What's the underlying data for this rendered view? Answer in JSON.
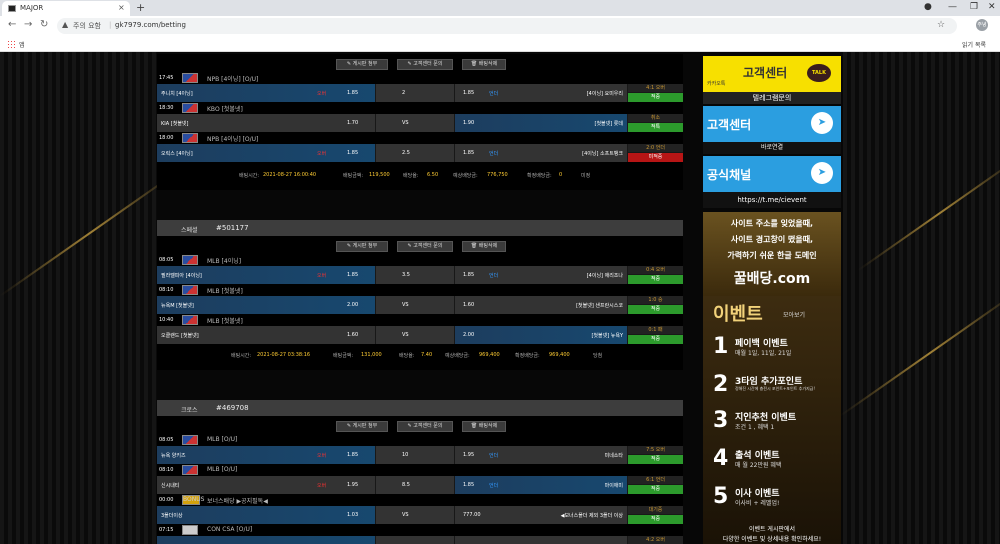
{
  "browser": {
    "tab_title": "MAJOR",
    "warn_label": "주의 요함",
    "url": "gk7979.com/betting",
    "apps_label": "앱",
    "reading_list": "읽기 목록",
    "avatar": "주녕"
  },
  "actions": {
    "post": "✎ 게시판 첨부",
    "contact": "✎ 고객센터 문의",
    "delete": "🗑 배팅삭제"
  },
  "bets": [
    {
      "legs": [
        {
          "time": "17:45",
          "league": "NPB [4이닝] [O/U]",
          "home": "주니치 [4이닝]",
          "home_odds": "1.85",
          "mid_label": "오버",
          "line": "2",
          "away_odds": "1.85",
          "away_label": "언더",
          "away": "[4이닝] 요미우리",
          "result": "4:1 오버",
          "status": "적중",
          "status_type": "win",
          "sel": "home"
        },
        {
          "time": "18:30",
          "league": "KBO [첫볼넷]",
          "home": "KIA [첫볼넷]",
          "home_odds": "1.70",
          "mid_label": "",
          "line": "VS",
          "away_odds": "1.90",
          "away_label": "",
          "away": "[첫볼넷] 롯데",
          "result": "취소",
          "status": "적특",
          "status_type": "win",
          "sel": "away"
        },
        {
          "time": "18:00",
          "league": "NPB [4이닝] [O/U]",
          "home": "오릭스 [4이닝]",
          "home_odds": "1.85",
          "mid_label": "오버",
          "line": "2.5",
          "away_odds": "1.85",
          "away_label": "언더",
          "away": "[4이닝] 소프트뱅크",
          "result": "2:0 언더",
          "status": "미적중",
          "status_type": "lose",
          "sel": "home"
        }
      ],
      "summary": {
        "time_lbl": "배팅시간:",
        "time": "2021-08-27 16:00:40",
        "amt_lbl": "배팅금액:",
        "amt": "119,500",
        "odds_lbl": "배당율:",
        "odds": "6.50",
        "exp_lbl": "예상배당금:",
        "exp": "776,750",
        "conf_lbl": "확정배당금:",
        "conf": "0",
        "state": "미정"
      }
    },
    {
      "type": "스페셜",
      "id": "#501177",
      "legs": [
        {
          "time": "08:05",
          "league": "MLB [4이닝]",
          "home": "필라델피아 [4이닝]",
          "home_odds": "1.85",
          "mid_label": "오버",
          "line": "3.5",
          "away_odds": "1.85",
          "away_label": "언더",
          "away": "[4이닝] 애리조나",
          "result": "0:4 오버",
          "status": "적중",
          "status_type": "win",
          "sel": "home"
        },
        {
          "time": "08:10",
          "league": "MLB [첫볼넷]",
          "home": "뉴욕M [첫볼넷]",
          "home_odds": "2.00",
          "mid_label": "",
          "line": "VS",
          "away_odds": "1.60",
          "away_label": "",
          "away": "[첫볼넷] 샌프란시스코",
          "result": "1:0 승",
          "status": "적중",
          "status_type": "win",
          "sel": "home"
        },
        {
          "time": "10:40",
          "league": "MLB [첫볼넷]",
          "home": "오클랜드 [첫볼넷]",
          "home_odds": "1.60",
          "mid_label": "",
          "line": "VS",
          "away_odds": "2.00",
          "away_label": "",
          "away": "[첫볼넷] 뉴욕Y",
          "result": "0:1 패",
          "status": "적중",
          "status_type": "win",
          "sel": "away"
        }
      ],
      "summary": {
        "time_lbl": "배팅시간:",
        "time": "2021-08-27 03:38:16",
        "amt_lbl": "배팅금액:",
        "amt": "131,000",
        "odds_lbl": "배당율:",
        "odds": "7.40",
        "exp_lbl": "예상배당금:",
        "exp": "969,400",
        "conf_lbl": "확정배당금:",
        "conf": "969,400",
        "state": "당첨"
      }
    },
    {
      "type": "크로스",
      "id": "#469708",
      "legs": [
        {
          "time": "08:05",
          "league": "MLB [O/U]",
          "home": "뉴욕 양키즈",
          "home_odds": "1.85",
          "mid_label": "오버",
          "line": "10",
          "away_odds": "1.95",
          "away_label": "언더",
          "away": "미네소타",
          "result": "7:5 오버",
          "status": "적중",
          "status_type": "win",
          "sel": "home"
        },
        {
          "time": "08:10",
          "league": "MLB [O/U]",
          "home": "신시내티",
          "home_odds": "1.95",
          "mid_label": "오버",
          "line": "8.5",
          "away_odds": "1.85",
          "away_label": "언더",
          "away": "마이애미",
          "result": "6:1 언더",
          "status": "적중",
          "status_type": "win",
          "sel": "away"
        },
        {
          "time": "00:00",
          "league": "보너스배당 ▶공지필독◀",
          "home": "3폴더이상",
          "home_odds": "1.03",
          "mid_label": "",
          "line": "VS",
          "away_odds": "777.00",
          "away_label": "",
          "away": "◀보너스폴더 제외 3폴더 이상",
          "result": "대기중",
          "status": "적중",
          "status_type": "wait",
          "sel": "home",
          "bonus": "BONUS"
        },
        {
          "time": "07:15",
          "league": "CON CSA [O/U]",
          "home": "",
          "home_odds": "",
          "mid_label": "",
          "line": "",
          "away_odds": "",
          "away_label": "",
          "away": "",
          "result": "4:2 오버",
          "status": "",
          "status_type": "win",
          "sel": "home"
        }
      ]
    }
  ],
  "side": {
    "kakao": {
      "label": "카카오톡",
      "title": "고객센터",
      "talk": "TALK",
      "sub": "텔레그램문의"
    },
    "tele1": {
      "title": "고객센터",
      "sub": "바로연결"
    },
    "tele2": {
      "title": "공식채널",
      "sub": "https://t.me/cievent"
    },
    "ad1": {
      "l1": "사이트 주소를 잊었을때,",
      "l2": "사이트 경고창이 떴을때,",
      "l3": "가력하기 쉬운 한글 도메인",
      "l4": "꿀배당.com"
    },
    "ad2": {
      "title": "이벤트",
      "sub": "모아보기",
      "events": [
        {
          "n": "1",
          "a": "페이백 이벤트",
          "b": "매월 1일, 11일, 21일"
        },
        {
          "n": "2",
          "a": "3타임 추가포인트",
          "b": "정해진 시간에 충전시 포인트+포인트 추가지급!"
        },
        {
          "n": "3",
          "a": "지인추천 이벤트",
          "b": "조건 1 , 혜택 1"
        },
        {
          "n": "4",
          "a": "출석 이벤트",
          "b": "매 월 22만원 혜택"
        },
        {
          "n": "5",
          "a": "이사 이벤트",
          "b": "이사비 + 레벨업!"
        }
      ],
      "foot1": "이벤트 게시판에서",
      "foot2": "다양한 이벤트 및 상세내용 확인하세요!"
    }
  }
}
